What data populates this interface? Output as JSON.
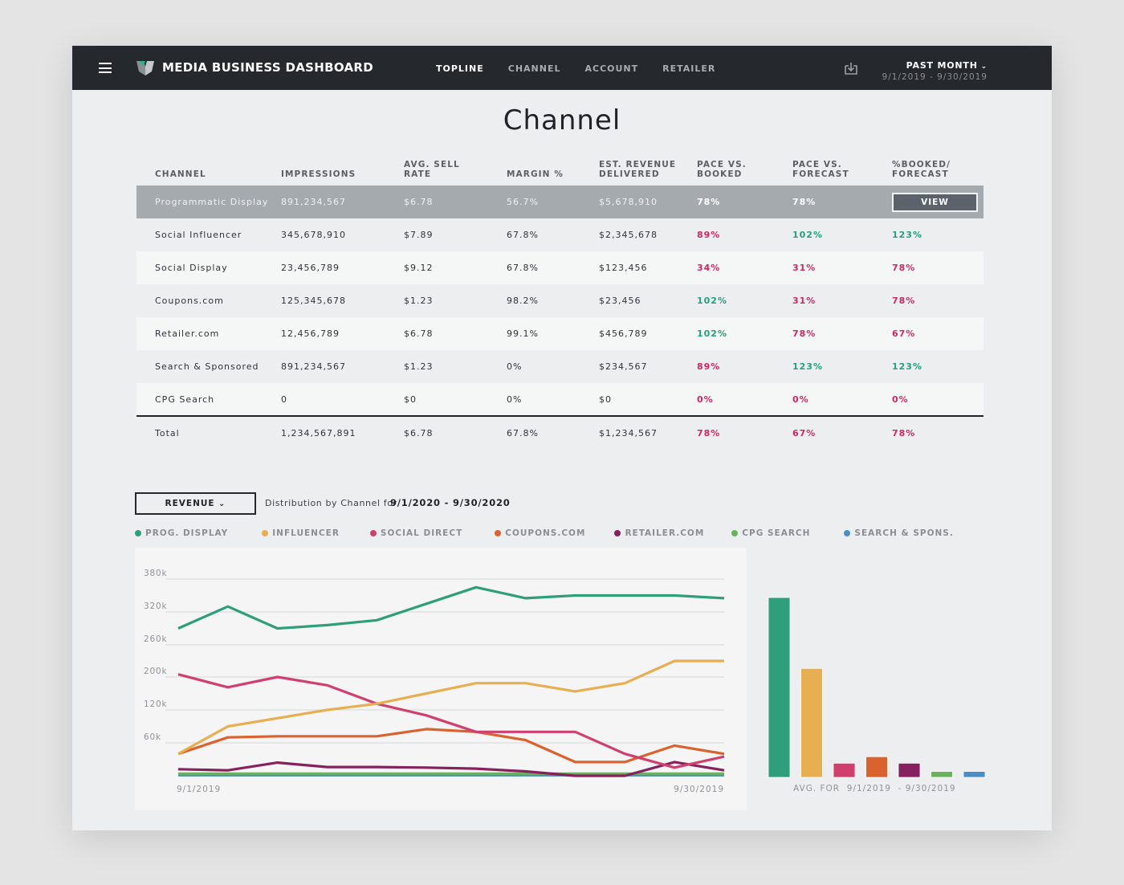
{
  "header": {
    "app_title": "MEDIA BUSINESS DASHBOARD",
    "nav": [
      {
        "label": "TOPLINE",
        "active": true
      },
      {
        "label": "CHANNEL",
        "active": false
      },
      {
        "label": "ACCOUNT",
        "active": false
      },
      {
        "label": "RETAILER",
        "active": false
      }
    ],
    "period_label": "PAST MONTH",
    "period_range": "9/1/2019 - 9/30/2019",
    "icons": {
      "menu": "hamburger-icon",
      "logo": "logo-icon",
      "download": "download-icon",
      "chevron": "chevron-down-icon"
    }
  },
  "page": {
    "title": "Channel"
  },
  "table": {
    "headers": [
      "CHANNEL",
      "IMPRESSIONS",
      "AVG. SELL RATE",
      "MARGIN %",
      "EST. REVENUE DELIVERED",
      "PACE VS. BOOKED",
      "PACE VS. FORECAST",
      "%BOOKED/ FORECAST"
    ],
    "rows": [
      {
        "channel": "Programmatic Display",
        "impressions": "891,234,567",
        "avg_sell_rate": "$6.78",
        "margin": "56.7%",
        "est_revenue": "$5,678,910",
        "pace_booked": "78%",
        "pace_booked_status": "neutral",
        "pace_forecast": "78%",
        "pace_forecast_status": "neutral",
        "booked_forecast": "VIEW",
        "booked_forecast_status": "button",
        "selected": true
      },
      {
        "channel": "Social Influencer",
        "impressions": "345,678,910",
        "avg_sell_rate": "$7.89",
        "margin": "67.8%",
        "est_revenue": "$2,345,678",
        "pace_booked": "89%",
        "pace_booked_status": "neg",
        "pace_forecast": "102%",
        "pace_forecast_status": "pos",
        "booked_forecast": "123%",
        "booked_forecast_status": "pos"
      },
      {
        "channel": "Social Display",
        "impressions": "23,456,789",
        "avg_sell_rate": "$9.12",
        "margin": "67.8%",
        "est_revenue": "$123,456",
        "pace_booked": "34%",
        "pace_booked_status": "neg",
        "pace_forecast": "31%",
        "pace_forecast_status": "neg",
        "booked_forecast": "78%",
        "booked_forecast_status": "neg"
      },
      {
        "channel": "Coupons.com",
        "impressions": "125,345,678",
        "avg_sell_rate": "$1.23",
        "margin": "98.2%",
        "est_revenue": "$23,456",
        "pace_booked": "102%",
        "pace_booked_status": "pos",
        "pace_forecast": "31%",
        "pace_forecast_status": "neg",
        "booked_forecast": "78%",
        "booked_forecast_status": "neg"
      },
      {
        "channel": "Retailer.com",
        "impressions": "12,456,789",
        "avg_sell_rate": "$6.78",
        "margin": "99.1%",
        "est_revenue": "$456,789",
        "pace_booked": "102%",
        "pace_booked_status": "pos",
        "pace_forecast": "78%",
        "pace_forecast_status": "neg",
        "booked_forecast": "67%",
        "booked_forecast_status": "neg"
      },
      {
        "channel": "Search & Sponsored",
        "impressions": "891,234,567",
        "avg_sell_rate": "$1.23",
        "margin": "0%",
        "est_revenue": "$234,567",
        "pace_booked": "89%",
        "pace_booked_status": "neg",
        "pace_forecast": "123%",
        "pace_forecast_status": "pos",
        "booked_forecast": "123%",
        "booked_forecast_status": "pos"
      },
      {
        "channel": "CPG Search",
        "impressions": "0",
        "avg_sell_rate": "$0",
        "margin": "0%",
        "est_revenue": "$0",
        "pace_booked": "0%",
        "pace_booked_status": "neg",
        "pace_forecast": "0%",
        "pace_forecast_status": "neg",
        "booked_forecast": "0%",
        "booked_forecast_status": "neg"
      }
    ],
    "total": {
      "channel": "Total",
      "impressions": "1,234,567,891",
      "avg_sell_rate": "$6.78",
      "margin": "67.8%",
      "est_revenue": "$1,234,567",
      "pace_booked": "78%",
      "pace_booked_status": "neg",
      "pace_forecast": "67%",
      "pace_forecast_status": "neg",
      "booked_forecast": "78%",
      "booked_forecast_status": "neg"
    }
  },
  "chart_controls": {
    "metric_select": "REVENUE",
    "distribution_label": "Distribution by Channel for",
    "distribution_range": "9/1/2020 - 9/30/2020"
  },
  "colors": {
    "prog_display": "#2e9e7b",
    "influencer": "#e8ae52",
    "social_direct": "#d0406e",
    "coupons": "#d9622e",
    "retailer": "#86205e",
    "cpg_search": "#6ab25c",
    "search_spons": "#4b8ec6",
    "positive": "#25a07b",
    "negative": "#d3285f"
  },
  "chart_data": [
    {
      "type": "line",
      "title": "Distribution by Channel for 9/1/2020 - 9/30/2020",
      "xlabel": "",
      "ylabel": "Revenue",
      "x_tick_labels": [
        "9/1/2019",
        "9/30/2019"
      ],
      "y_tick_labels": [
        "380k",
        "320k",
        "260k",
        "200k",
        "120k",
        "60k"
      ],
      "y_tick_values": [
        380000,
        320000,
        260000,
        200000,
        120000,
        60000
      ],
      "ylim": [
        0,
        380000
      ],
      "grid": true,
      "legend_position": "top",
      "x": [
        1,
        2,
        3,
        4,
        5,
        6,
        7,
        8,
        9,
        10,
        11,
        12
      ],
      "series": [
        {
          "name": "PROG. DISPLAY",
          "color_key": "prog_display",
          "values": [
            290000,
            330000,
            290000,
            296000,
            305000,
            335000,
            365000,
            345000,
            350000,
            350000,
            350000,
            345000
          ]
        },
        {
          "name": "INFLUENCER",
          "color_key": "influencer",
          "values": [
            40000,
            90000,
            105000,
            120000,
            135000,
            160000,
            185000,
            185000,
            165000,
            185000,
            230000,
            230000
          ]
        },
        {
          "name": "SOCIAL DIRECT",
          "color_key": "social_direct",
          "values": [
            205000,
            175000,
            200000,
            180000,
            135000,
            110000,
            80000,
            80000,
            80000,
            40000,
            15000,
            35000
          ]
        },
        {
          "name": "COUPONS.COM",
          "color_key": "coupons",
          "values": [
            40000,
            70000,
            72000,
            72000,
            72000,
            85000,
            80000,
            65000,
            25000,
            25000,
            55000,
            40000
          ]
        },
        {
          "name": "RETAILER.COM",
          "color_key": "retailer",
          "values": [
            12000,
            10000,
            24000,
            16000,
            16000,
            15000,
            13000,
            8000,
            0,
            0,
            25000,
            10000
          ]
        },
        {
          "name": "CPG SEARCH",
          "color_key": "cpg_search",
          "values": [
            4000,
            4000,
            4000,
            4000,
            4000,
            4000,
            4000,
            4000,
            4000,
            4000,
            4000,
            4000
          ]
        },
        {
          "name": "SEARCH & SPONS.",
          "color_key": "search_spons",
          "values": [
            1000,
            1000,
            1000,
            1000,
            1000,
            1000,
            1000,
            1000,
            1000,
            1000,
            1000,
            1000
          ]
        }
      ]
    },
    {
      "type": "bar",
      "title": "",
      "xlabel": "AVG. FOR  9/1/2019  - 9/30/2019",
      "ylabel": "",
      "categories": [
        "PROG. DISPLAY",
        "INFLUENCER",
        "SOCIAL DIRECT",
        "COUPONS.COM",
        "RETAILER.COM",
        "CPG SEARCH",
        "SEARCH & SPONS."
      ],
      "color_keys": [
        "prog_display",
        "influencer",
        "social_direct",
        "coupons",
        "retailer",
        "cpg_search",
        "search_spons"
      ],
      "values": [
        330000,
        200000,
        26000,
        38000,
        26000,
        11000,
        11000
      ],
      "ylim": [
        0,
        330000
      ],
      "grid": false
    }
  ]
}
